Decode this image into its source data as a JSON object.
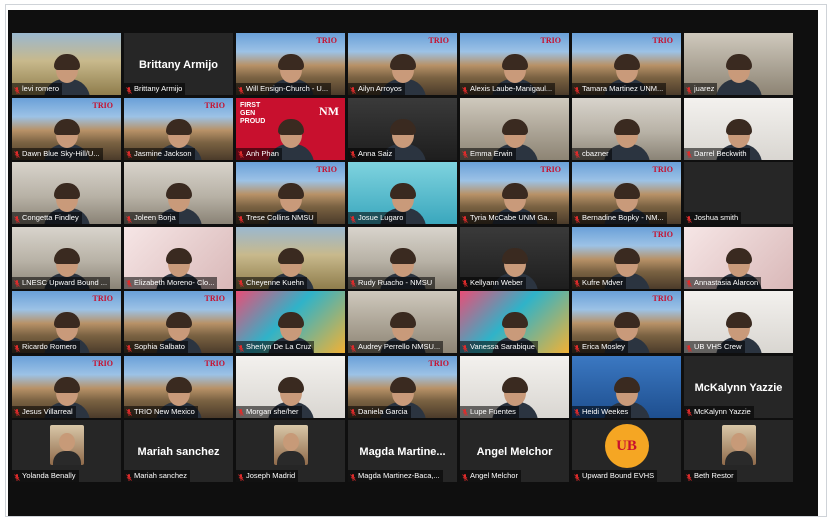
{
  "trio_logo_text": "TRIO",
  "first_gen_text": "FIRST\nGEN\nPROUD",
  "nm_logo_text": "NM",
  "ub_logo_text": "UB",
  "participants": [
    {
      "name": "levi romero",
      "bg": "grass",
      "active": true
    },
    {
      "name": "Brittany Armijo",
      "bg": "none",
      "big": "Brittany Armijo"
    },
    {
      "name": "Will Ensign-Church - U...",
      "bg": "trio"
    },
    {
      "name": "Ailyn Arroyos",
      "bg": "trio"
    },
    {
      "name": "Alexis Laube-Manigaul...",
      "bg": "trio"
    },
    {
      "name": "Tamara Martinez UNM...",
      "bg": "trio"
    },
    {
      "name": "juarez",
      "bg": "office"
    },
    {
      "name": "Dawn Blue Sky-Hill/U...",
      "bg": "trio"
    },
    {
      "name": "Jasmine Jackson",
      "bg": "trio"
    },
    {
      "name": "Anh Phan",
      "bg": "red",
      "special": "firstgen"
    },
    {
      "name": "Anna Saiz",
      "bg": "dark"
    },
    {
      "name": "Emma Erwin",
      "bg": "office"
    },
    {
      "name": "cbazner",
      "bg": "room"
    },
    {
      "name": "Darrel Beckwith",
      "bg": "white"
    },
    {
      "name": "Congetta Findley",
      "bg": "room"
    },
    {
      "name": "Joleen Borja",
      "bg": "room"
    },
    {
      "name": "Trese Collins NMSU",
      "bg": "trio"
    },
    {
      "name": "Josue Lugaro",
      "bg": "teal"
    },
    {
      "name": "Tyria McCabe UNM Ga...",
      "bg": "trio"
    },
    {
      "name": "Bernadine Bopky - NM...",
      "bg": "trio"
    },
    {
      "name": "Joshua smith",
      "bg": "empty"
    },
    {
      "name": "LNESC Upward Bound ...",
      "bg": "room"
    },
    {
      "name": "Elizabeth Moreno- Clo...",
      "bg": "floral"
    },
    {
      "name": "Cheyenne Kuehn",
      "bg": "grass"
    },
    {
      "name": "Rudy Ruacho - NMSU",
      "bg": "room"
    },
    {
      "name": "Kellyann Weber",
      "bg": "dark"
    },
    {
      "name": "Kufre Mdver",
      "bg": "trio"
    },
    {
      "name": "Annastasia Alarcon",
      "bg": "floral"
    },
    {
      "name": "Ricardo Romero",
      "bg": "trio"
    },
    {
      "name": "Sophia Salbato",
      "bg": "trio"
    },
    {
      "name": "Sherlyn De La Cruz",
      "bg": "color"
    },
    {
      "name": "Audrey Perrello NMSU...",
      "bg": "office"
    },
    {
      "name": "Vanessa Sarabique",
      "bg": "color"
    },
    {
      "name": "Erica Mosley",
      "bg": "trio"
    },
    {
      "name": "UB VHS Crew",
      "bg": "white"
    },
    {
      "name": "Jesus Villarreal",
      "bg": "trio"
    },
    {
      "name": "TRIO New Mexico",
      "bg": "trio"
    },
    {
      "name": "Morgan she/her",
      "bg": "white"
    },
    {
      "name": "Daniela Garcia",
      "bg": "trio"
    },
    {
      "name": "Lupe Fuentes",
      "bg": "white"
    },
    {
      "name": "Heidi Weekes",
      "bg": "blue"
    },
    {
      "name": "McKalynn Yazzie",
      "bg": "none",
      "big": "McKalynn Yazzie"
    },
    {
      "name": "Yolanda Benally",
      "bg": "none",
      "photo": true
    },
    {
      "name": "Mariah sanchez",
      "bg": "none",
      "big": "Mariah sanchez"
    },
    {
      "name": "Joseph Madrid",
      "bg": "none",
      "photo": true
    },
    {
      "name": "Magda Martinez-Baca,...",
      "bg": "none",
      "big": "Magda  Martine..."
    },
    {
      "name": "Angel Melchor",
      "bg": "none",
      "big": "Angel Melchor"
    },
    {
      "name": "Upward Bound EVHS",
      "bg": "none",
      "special": "ub"
    },
    {
      "name": "Beth Restor",
      "bg": "none",
      "photo": true
    }
  ]
}
